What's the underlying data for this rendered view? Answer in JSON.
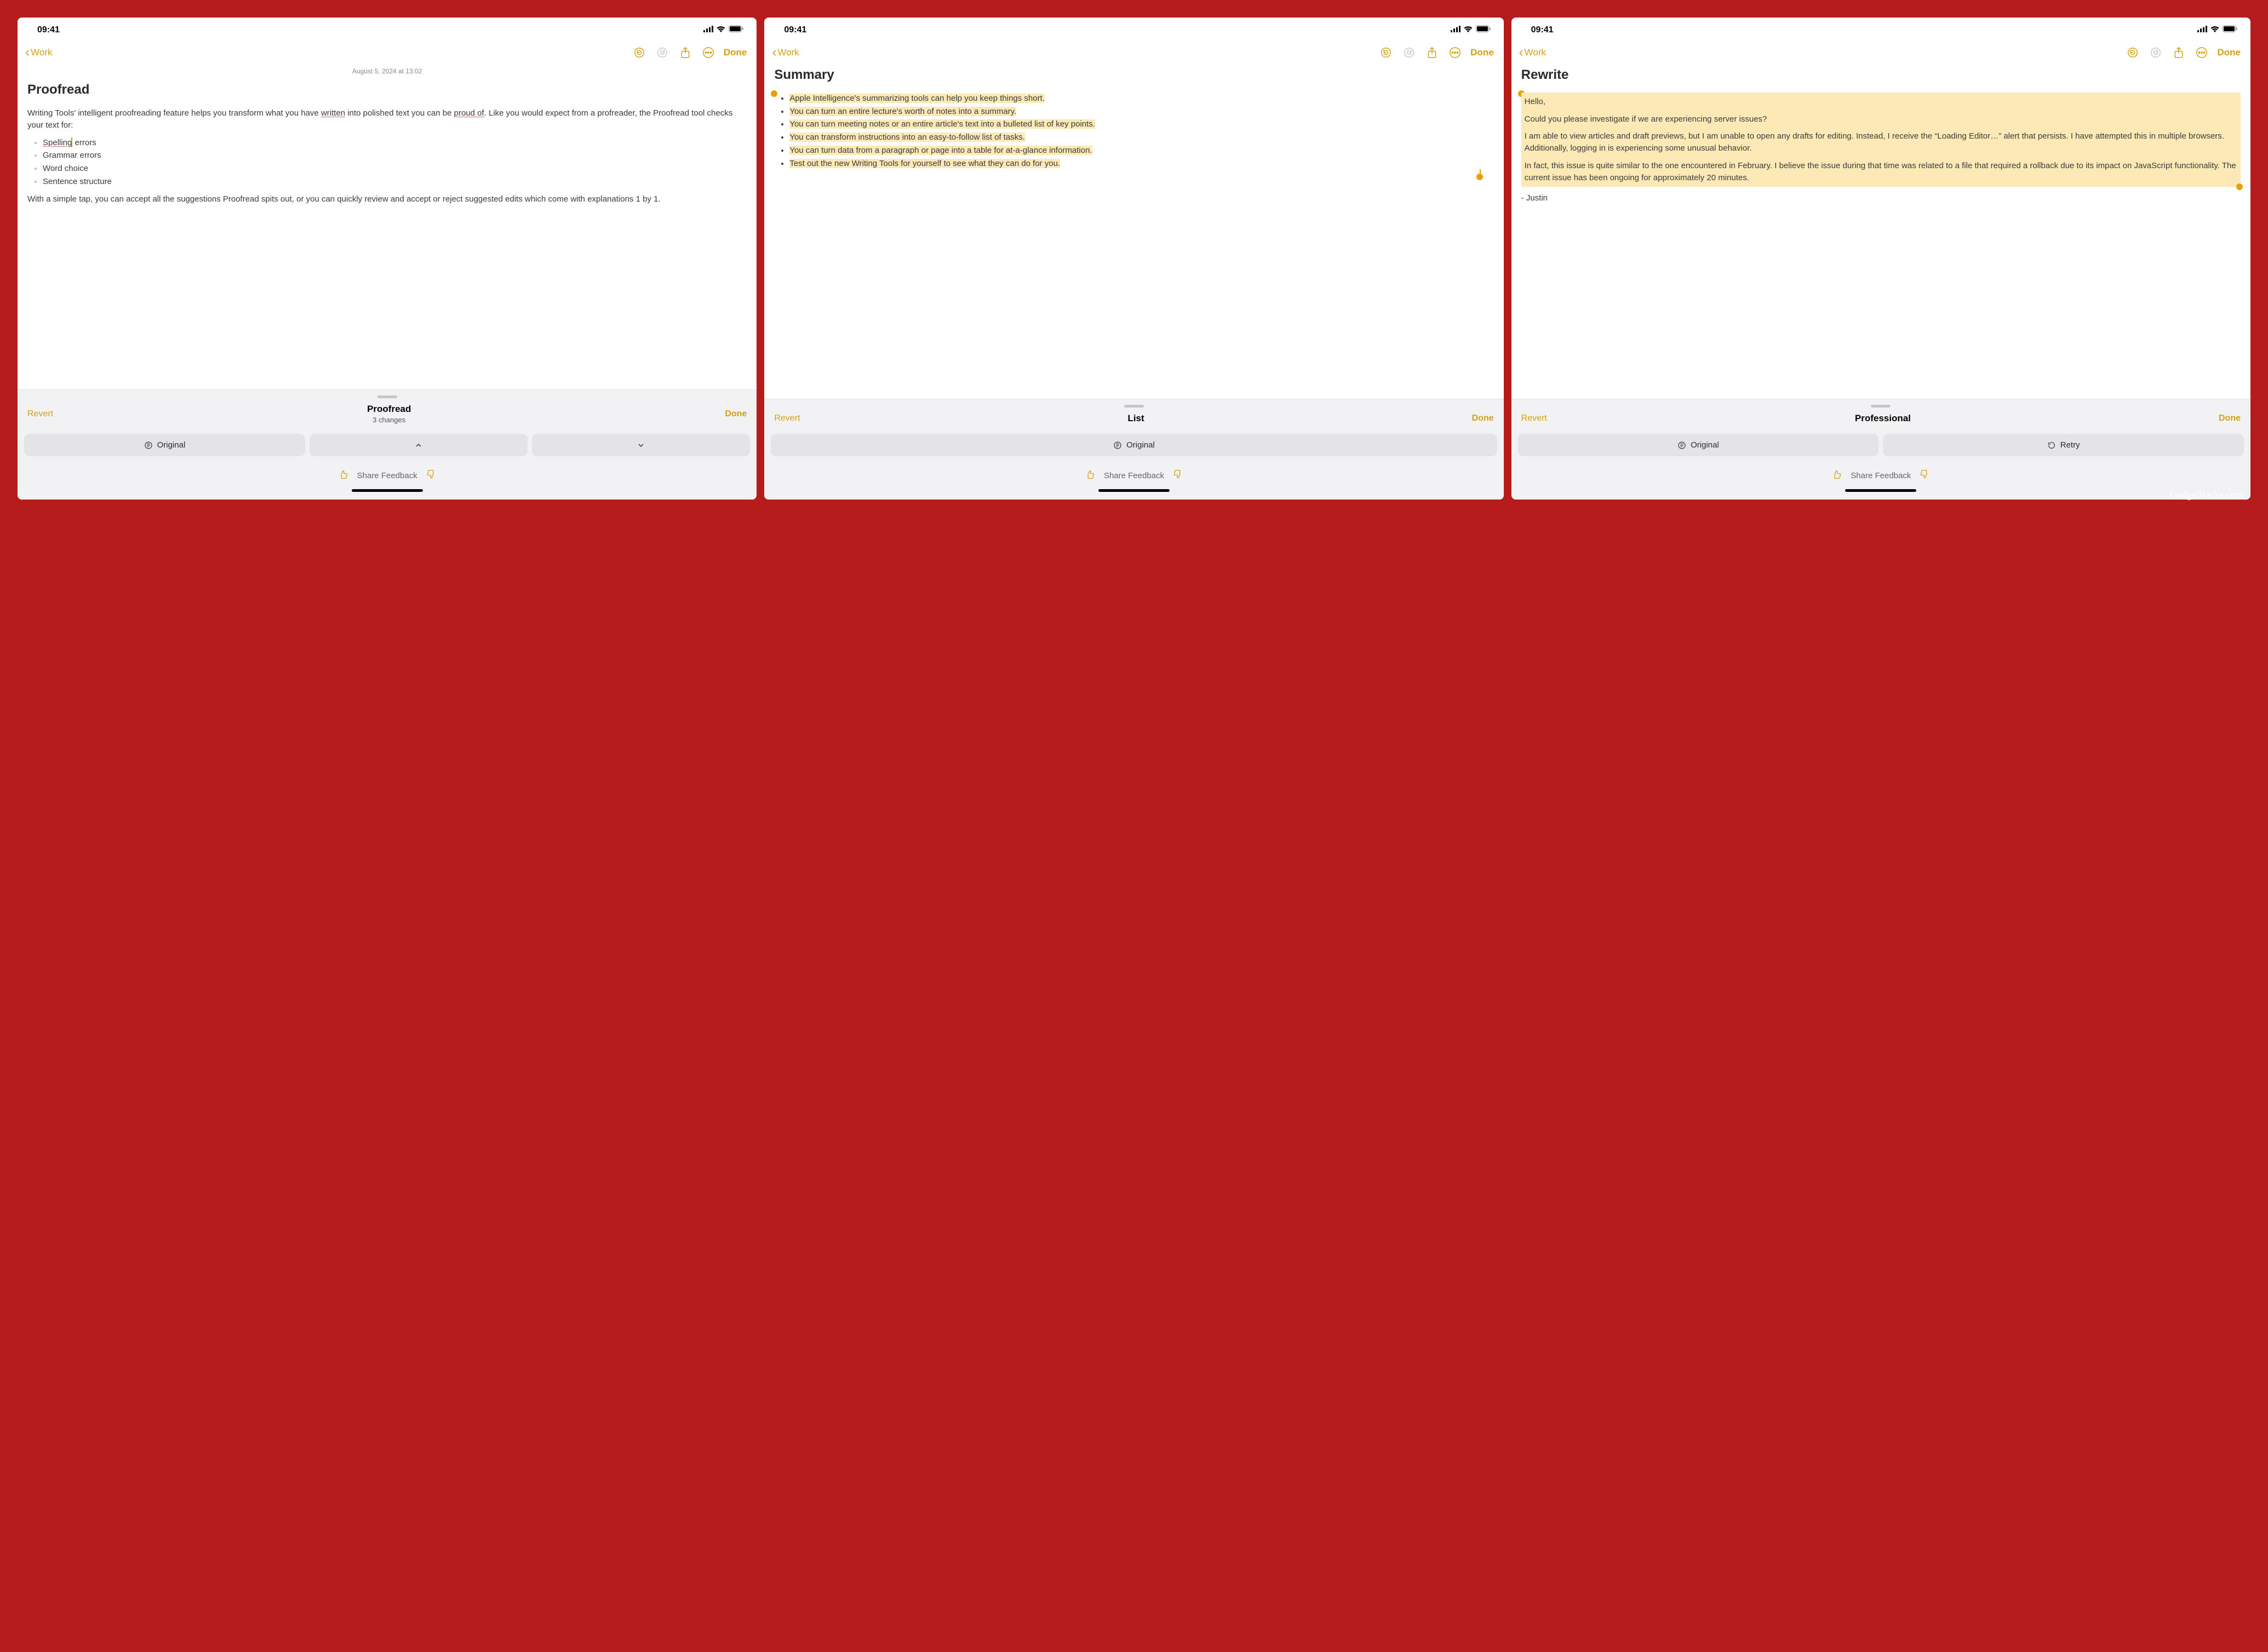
{
  "watermark": "GadgetHacks.com",
  "common": {
    "time": "09:41",
    "back_label": "Work",
    "done_label": "Done"
  },
  "panel1": {
    "date": "August 5, 2024 at 13:02",
    "title": "Proofread",
    "p1_a": "Writing Tools' intelligent proofreading feature helps you transform what you have ",
    "p1_written": "written",
    "p1_b": " into polished text you can be ",
    "p1_proud": "proud of",
    "p1_c": ". Like you would expect from a profreader, the Proofread tool checks your text for:",
    "list": {
      "i1a": "Spelling",
      "i1b": " errors",
      "i2": "Grammar errors",
      "i3": "Word choice",
      "i4": "Sentence structure"
    },
    "p2": "With a simple tap, you can accept all the suggestions Proofread spits out, or you can quickly review and accept or reject suggested edits which come with explanations 1 by 1.",
    "sheet": {
      "revert": "Revert",
      "title": "Proofread",
      "sub": "3 changes",
      "done": "Done",
      "original": "Original",
      "share": "Share Feedback"
    }
  },
  "panel2": {
    "title": "Summary",
    "items": [
      "Apple Intelligence's summarizing tools can help you keep things short.",
      "You can turn an entire lecture's worth of notes into a summary.",
      "You can turn meeting notes or an entire article's text into a bulleted list of key points.",
      "You can transform instructions into an easy-to-follow list of tasks.",
      "You can turn data from a paragraph or page into a table for at-a-glance information.",
      "Test out the new Writing Tools for yourself to see what they can do for you."
    ],
    "sheet": {
      "revert": "Revert",
      "title": "List",
      "done": "Done",
      "original": "Original",
      "share": "Share Feedback"
    }
  },
  "panel3": {
    "title": "Rewrite",
    "greeting": "Hello,",
    "p1": "Could you please investigate if we are experiencing server issues?",
    "p2": "I am able to view articles and draft previews, but I am unable to open any drafts for editing. Instead, I receive the “Loading Editor…” alert that persists. I have attempted this in multiple browsers. Additionally, logging in is experiencing some unusual behavior.",
    "p3": "In fact, this issue is quite similar to the one encountered in February. I believe the issue during that time was related to a file that required a rollback due to its impact on JavaScript functionality. The current issue has been ongoing for approximately 20 minutes.",
    "signoff": "- Justin",
    "sheet": {
      "revert": "Revert",
      "title": "Professional",
      "done": "Done",
      "original": "Original",
      "retry": "Retry",
      "share": "Share Feedback"
    }
  }
}
